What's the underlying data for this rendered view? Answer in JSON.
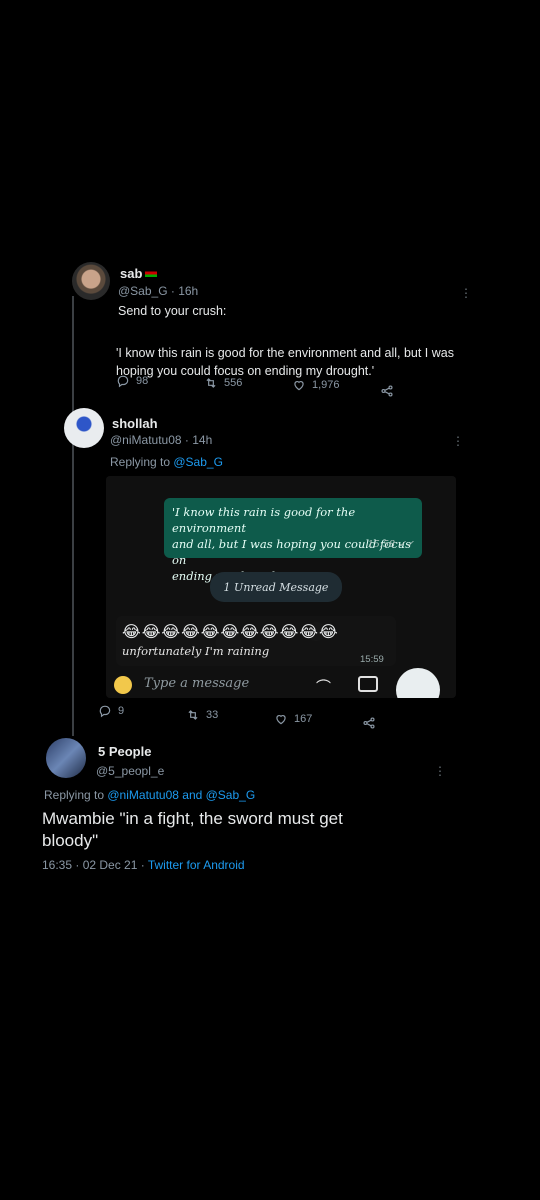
{
  "tweet1": {
    "name": "sab",
    "handle_time": "@Sab_G · 16h",
    "line1": "Send to your crush:",
    "quote_line1": "'I know this rain is good for the environment and all, but I was",
    "quote_line2": "hoping you could focus on ending my drought.'",
    "replies": "98",
    "retweets": "556",
    "likes": "1,976"
  },
  "tweet2": {
    "name": "shollah",
    "handle_time": "@niMatutu08 · 14h",
    "replying_prefix": "Replying to ",
    "replying_handle": "@Sab_G",
    "replies": "9",
    "retweets": "33",
    "likes": "167",
    "whatsapp": {
      "out_line1": "'I know this rain is good for the environment",
      "out_line2": "and all, but I was hoping you could focus on",
      "out_line3": "ending my drought.'",
      "out_time": "15:58 ✓✓",
      "unread": "1 Unread Message",
      "emoji": "😂😂😂😂😂😂😂😂😂😂😂",
      "in_text": "unfortunately I'm raining",
      "in_time": "15:59",
      "placeholder": "Type a message"
    }
  },
  "tweet3": {
    "name": "5 People",
    "handle": "@5_peopl_e",
    "replying_prefix": "Replying to ",
    "replying_handles": "@niMatutu08 and @Sab_G",
    "text_line1": "Mwambie \"in a fight, the sword must get",
    "text_line2": "bloody\"",
    "meta": "16:35 · 02 Dec 21 · ",
    "source": "Twitter for Android"
  },
  "colors": {
    "accent": "#1d9bf0",
    "wa_green": "#0e5b4b",
    "background": "#000000"
  }
}
